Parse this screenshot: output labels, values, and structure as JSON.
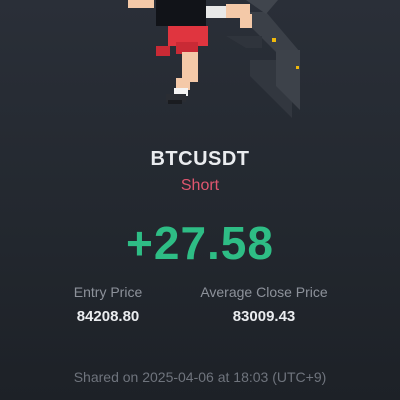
{
  "card": {
    "symbol": "BTCUSDT",
    "side": "Short",
    "pnl": "+27.58",
    "entry_price_label": "Entry Price",
    "entry_price_value": "84208.80",
    "avg_close_label": "Average Close Price",
    "avg_close_value": "83009.43",
    "shared_text": "Shared on 2025-04-06 at 18:03 (UTC+9)"
  },
  "colors": {
    "background": "#262b33",
    "short": "#e0566f",
    "profit": "#2ebd85",
    "accent": "#f0b90b"
  },
  "icons": {
    "illustration": "pixel-character-jumping-illustration"
  }
}
